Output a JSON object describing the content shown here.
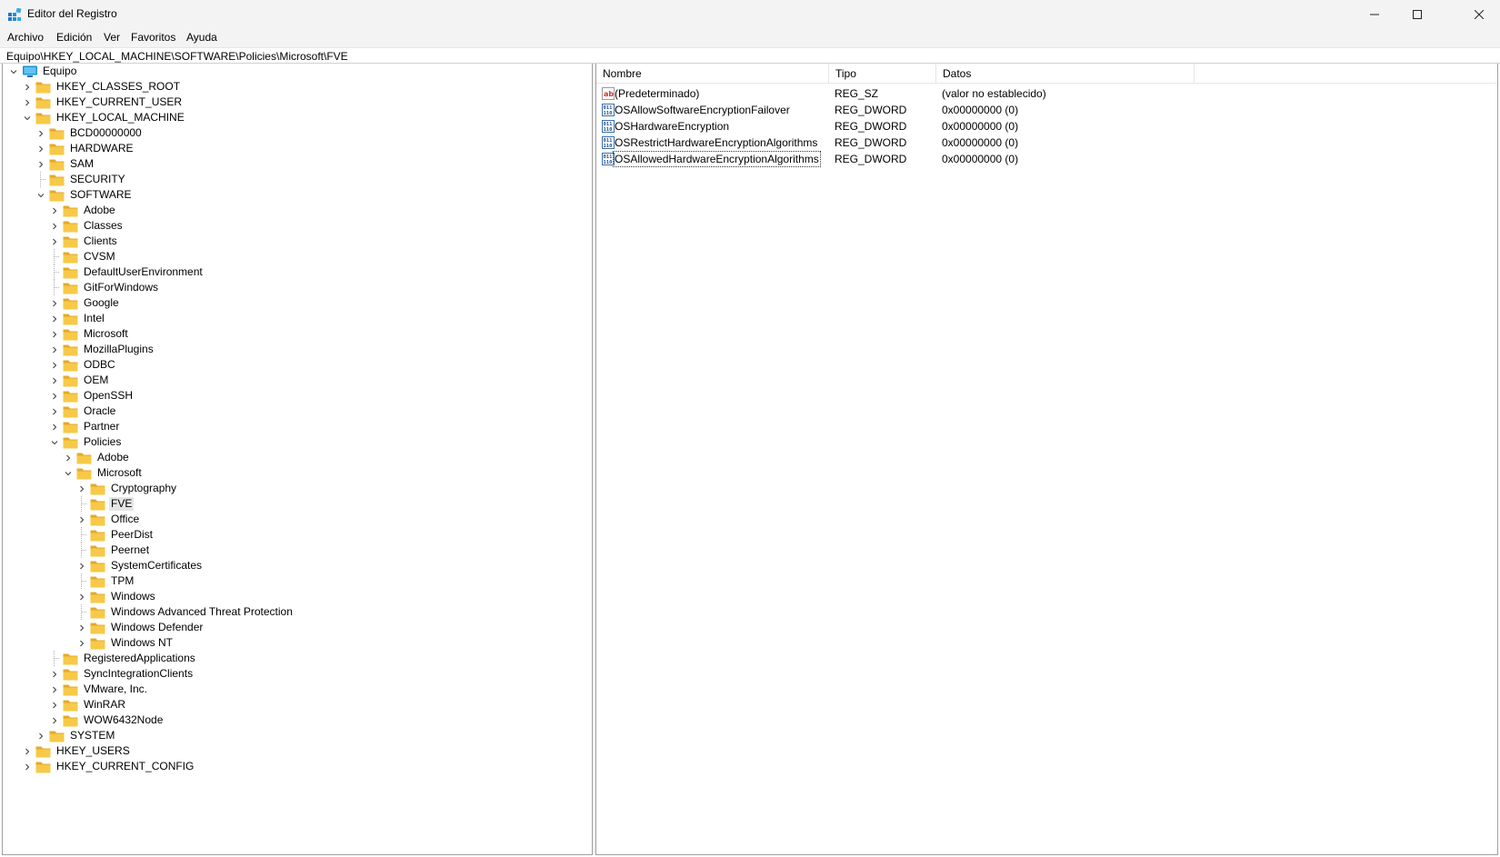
{
  "window": {
    "title": "Editor del Registro",
    "app_icon": "registry-editor-icon",
    "controls": [
      "minimize-icon",
      "maximize-icon",
      "close-icon"
    ]
  },
  "menu": {
    "items": [
      "Archivo",
      "Edición",
      "Ver",
      "Favoritos",
      "Ayuda"
    ]
  },
  "address": {
    "path": "Equipo\\HKEY_LOCAL_MACHINE\\SOFTWARE\\Policies\\Microsoft\\FVE"
  },
  "colors": {
    "folder": "#f7c948",
    "folder_dark": "#e5a92a",
    "selection": "#e5e5e5",
    "pc_icon": "#1e90d6"
  },
  "tree": {
    "nodes": [
      {
        "label": "Equipo",
        "depth": 0,
        "expander": "expanded",
        "icon": "computer-icon"
      },
      {
        "label": "HKEY_CLASSES_ROOT",
        "depth": 1,
        "expander": "collapsed"
      },
      {
        "label": "HKEY_CURRENT_USER",
        "depth": 1,
        "expander": "collapsed"
      },
      {
        "label": "HKEY_LOCAL_MACHINE",
        "depth": 1,
        "expander": "expanded"
      },
      {
        "label": "BCD00000000",
        "depth": 2,
        "expander": "collapsed"
      },
      {
        "label": "HARDWARE",
        "depth": 2,
        "expander": "collapsed"
      },
      {
        "label": "SAM",
        "depth": 2,
        "expander": "collapsed"
      },
      {
        "label": "SECURITY",
        "depth": 2,
        "expander": "none"
      },
      {
        "label": "SOFTWARE",
        "depth": 2,
        "expander": "expanded"
      },
      {
        "label": "Adobe",
        "depth": 3,
        "expander": "collapsed"
      },
      {
        "label": "Classes",
        "depth": 3,
        "expander": "collapsed"
      },
      {
        "label": "Clients",
        "depth": 3,
        "expander": "collapsed"
      },
      {
        "label": "CVSM",
        "depth": 3,
        "expander": "none"
      },
      {
        "label": "DefaultUserEnvironment",
        "depth": 3,
        "expander": "none"
      },
      {
        "label": "GitForWindows",
        "depth": 3,
        "expander": "none"
      },
      {
        "label": "Google",
        "depth": 3,
        "expander": "collapsed"
      },
      {
        "label": "Intel",
        "depth": 3,
        "expander": "collapsed"
      },
      {
        "label": "Microsoft",
        "depth": 3,
        "expander": "collapsed"
      },
      {
        "label": "MozillaPlugins",
        "depth": 3,
        "expander": "collapsed"
      },
      {
        "label": "ODBC",
        "depth": 3,
        "expander": "collapsed"
      },
      {
        "label": "OEM",
        "depth": 3,
        "expander": "collapsed"
      },
      {
        "label": "OpenSSH",
        "depth": 3,
        "expander": "collapsed"
      },
      {
        "label": "Oracle",
        "depth": 3,
        "expander": "collapsed"
      },
      {
        "label": "Partner",
        "depth": 3,
        "expander": "collapsed"
      },
      {
        "label": "Policies",
        "depth": 3,
        "expander": "expanded"
      },
      {
        "label": "Adobe",
        "depth": 4,
        "expander": "collapsed"
      },
      {
        "label": "Microsoft",
        "depth": 4,
        "expander": "expanded"
      },
      {
        "label": "Cryptography",
        "depth": 5,
        "expander": "collapsed"
      },
      {
        "label": "FVE",
        "depth": 5,
        "expander": "none",
        "selected": true
      },
      {
        "label": "Office",
        "depth": 5,
        "expander": "collapsed"
      },
      {
        "label": "PeerDist",
        "depth": 5,
        "expander": "none"
      },
      {
        "label": "Peernet",
        "depth": 5,
        "expander": "none"
      },
      {
        "label": "SystemCertificates",
        "depth": 5,
        "expander": "collapsed"
      },
      {
        "label": "TPM",
        "depth": 5,
        "expander": "none"
      },
      {
        "label": "Windows",
        "depth": 5,
        "expander": "collapsed"
      },
      {
        "label": "Windows Advanced Threat Protection",
        "depth": 5,
        "expander": "none"
      },
      {
        "label": "Windows Defender",
        "depth": 5,
        "expander": "collapsed"
      },
      {
        "label": "Windows NT",
        "depth": 5,
        "expander": "collapsed"
      },
      {
        "label": "RegisteredApplications",
        "depth": 3,
        "expander": "none"
      },
      {
        "label": "SyncIntegrationClients",
        "depth": 3,
        "expander": "collapsed"
      },
      {
        "label": "VMware, Inc.",
        "depth": 3,
        "expander": "collapsed"
      },
      {
        "label": "WinRAR",
        "depth": 3,
        "expander": "collapsed"
      },
      {
        "label": "WOW6432Node",
        "depth": 3,
        "expander": "collapsed"
      },
      {
        "label": "SYSTEM",
        "depth": 2,
        "expander": "collapsed"
      },
      {
        "label": "HKEY_USERS",
        "depth": 1,
        "expander": "collapsed"
      },
      {
        "label": "HKEY_CURRENT_CONFIG",
        "depth": 1,
        "expander": "collapsed"
      }
    ]
  },
  "list": {
    "columns": [
      "Nombre",
      "Tipo",
      "Datos"
    ],
    "rows": [
      {
        "name": "(Predeterminado)",
        "type": "REG_SZ",
        "data": "(valor no establecido)",
        "icon": "string-value-icon"
      },
      {
        "name": "OSAllowSoftwareEncryptionFailover",
        "type": "REG_DWORD",
        "data": "0x00000000 (0)",
        "icon": "binary-value-icon"
      },
      {
        "name": "OSHardwareEncryption",
        "type": "REG_DWORD",
        "data": "0x00000000 (0)",
        "icon": "binary-value-icon"
      },
      {
        "name": "OSRestrictHardwareEncryptionAlgorithms",
        "type": "REG_DWORD",
        "data": "0x00000000 (0)",
        "icon": "binary-value-icon"
      },
      {
        "name": "OSAllowedHardwareEncryptionAlgorithms",
        "type": "REG_DWORD",
        "data": "0x00000000 (0)",
        "icon": "binary-value-icon",
        "focused": true
      }
    ]
  }
}
